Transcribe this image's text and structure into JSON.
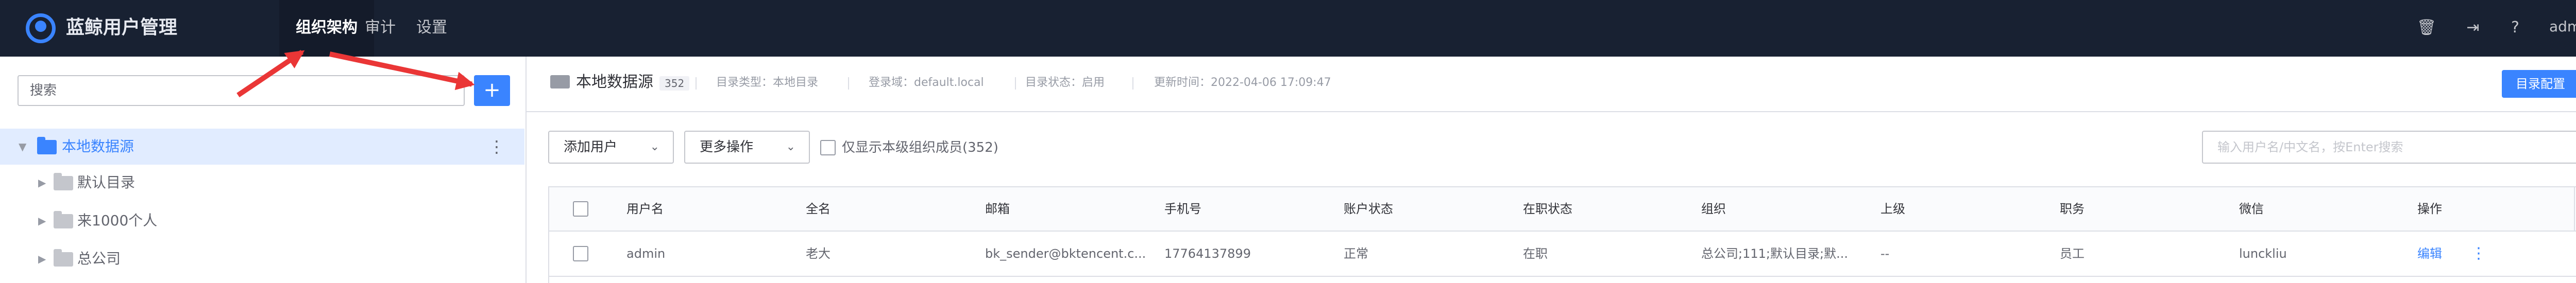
{
  "header": {
    "app_title": "蓝鲸用户管理",
    "nav": [
      "组织架构",
      "审计",
      "设置"
    ],
    "user": "admin"
  },
  "sidebar": {
    "search_placeholder": "搜索",
    "add_label": "+",
    "tree": [
      {
        "label": "本地数据源",
        "active": true
      },
      {
        "label": "默认目录"
      },
      {
        "label": "来1000个人"
      },
      {
        "label": "总公司"
      }
    ]
  },
  "source": {
    "name": "本地数据源",
    "count": "352",
    "type": "目录类型：本地目录",
    "domain": "登录域：default.local",
    "status": "目录状态：启用",
    "updated": "更新时间：2022-04-06 17:09:47",
    "config_button": "目录配置"
  },
  "toolbar": {
    "add_user": "添加用户",
    "more_actions": "更多操作",
    "only_this_level": "仅显示本级组织成员(352)",
    "search_placeholder": "输入用户名/中文名，按Enter搜索"
  },
  "table": {
    "columns": [
      "用户名",
      "全名",
      "邮箱",
      "手机号",
      "账户状态",
      "在职状态",
      "组织",
      "上级",
      "职务",
      "微信",
      "操作"
    ],
    "rows": [
      {
        "username": "admin",
        "fullname": "老大",
        "email": "bk_sender@bktencent.c...",
        "phone": "17764137899",
        "account_status": "正常",
        "job_status": "在职",
        "org": "总公司;111;默认目录;默...",
        "leader": "--",
        "title": "员工",
        "wechat": "lunckliu",
        "action": "编辑"
      }
    ]
  },
  "colors": {
    "accent": "#3a84ff",
    "header_bg": "#182132",
    "annotation": "#ea3636"
  }
}
